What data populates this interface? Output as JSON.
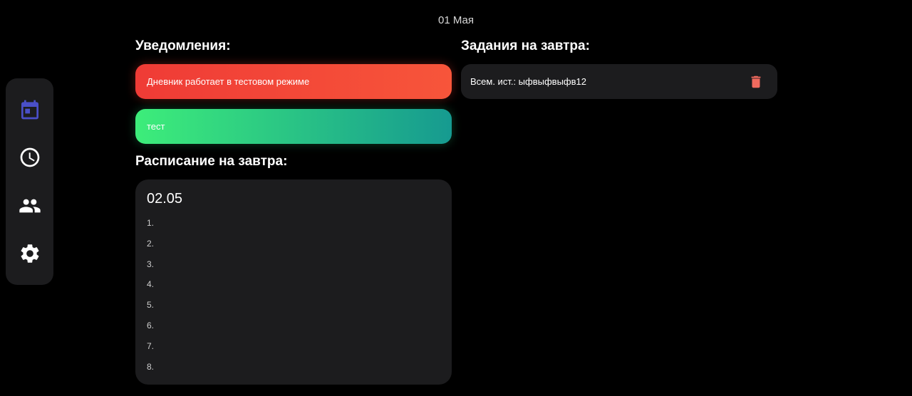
{
  "header": {
    "date": "01 Мая"
  },
  "colors": {
    "accent": "#4a4fc8",
    "danger": "#f06a5e",
    "notification_red": "#ef3b36",
    "notification_green": "#3ded7a"
  },
  "sidebar": {
    "items": [
      {
        "icon": "calendar-icon",
        "active": true
      },
      {
        "icon": "clock-icon",
        "active": false
      },
      {
        "icon": "people-icon",
        "active": false
      },
      {
        "icon": "gear-icon",
        "active": false
      }
    ]
  },
  "notifications": {
    "title": "Уведомления:",
    "items": [
      {
        "text": "Дневник работает в тестовом режиме"
      },
      {
        "text": "тест"
      }
    ]
  },
  "schedule": {
    "title": "Расписание на завтра:",
    "date": "02.05",
    "lessons": [
      "1.",
      "2.",
      "3.",
      "4.",
      "5.",
      "6.",
      "7.",
      "8."
    ]
  },
  "tasks": {
    "title": "Задания на завтра:",
    "items": [
      {
        "text": "Всем. ист.: ыфвыфвыфв12",
        "delete_icon": "trash-icon"
      }
    ]
  }
}
